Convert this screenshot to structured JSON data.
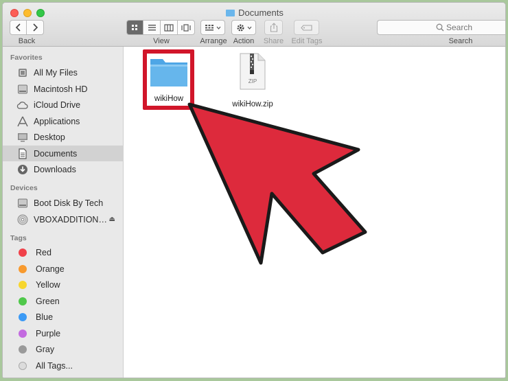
{
  "window": {
    "title": "Documents"
  },
  "toolbar": {
    "back_label": "Back",
    "view_label": "View",
    "arrange_label": "Arrange",
    "action_label": "Action",
    "share_label": "Share",
    "edit_tags_label": "Edit Tags",
    "search_label": "Search",
    "search_placeholder": "Search"
  },
  "sidebar": {
    "favorites_header": "Favorites",
    "favorites": [
      {
        "label": "All My Files",
        "icon": "all-files-icon"
      },
      {
        "label": "Macintosh HD",
        "icon": "hard-drive-icon"
      },
      {
        "label": "iCloud Drive",
        "icon": "cloud-icon"
      },
      {
        "label": "Applications",
        "icon": "applications-icon"
      },
      {
        "label": "Desktop",
        "icon": "desktop-icon"
      },
      {
        "label": "Documents",
        "icon": "documents-icon",
        "selected": true
      },
      {
        "label": "Downloads",
        "icon": "downloads-icon"
      }
    ],
    "devices_header": "Devices",
    "devices": [
      {
        "label": "Boot Disk By Tech",
        "icon": "disk-icon"
      },
      {
        "label": "VBOXADDITION…",
        "icon": "optical-disc-icon"
      }
    ],
    "tags_header": "Tags",
    "tags": [
      {
        "label": "Red",
        "color": "#f0414a"
      },
      {
        "label": "Orange",
        "color": "#f89a2e"
      },
      {
        "label": "Yellow",
        "color": "#f7d62e"
      },
      {
        "label": "Green",
        "color": "#4fc84a"
      },
      {
        "label": "Blue",
        "color": "#3c9af5"
      },
      {
        "label": "Purple",
        "color": "#c36be0"
      },
      {
        "label": "Gray",
        "color": "#9a9a9a"
      }
    ],
    "all_tags_label": "All Tags..."
  },
  "files": [
    {
      "name": "wikiHow",
      "type": "folder"
    },
    {
      "name": "wikiHow.zip",
      "type": "zip",
      "badge": "ZIP"
    }
  ],
  "colors": {
    "highlight": "#d1162a",
    "arrow": "#dd2a3c",
    "folder": "#66b6ec"
  }
}
